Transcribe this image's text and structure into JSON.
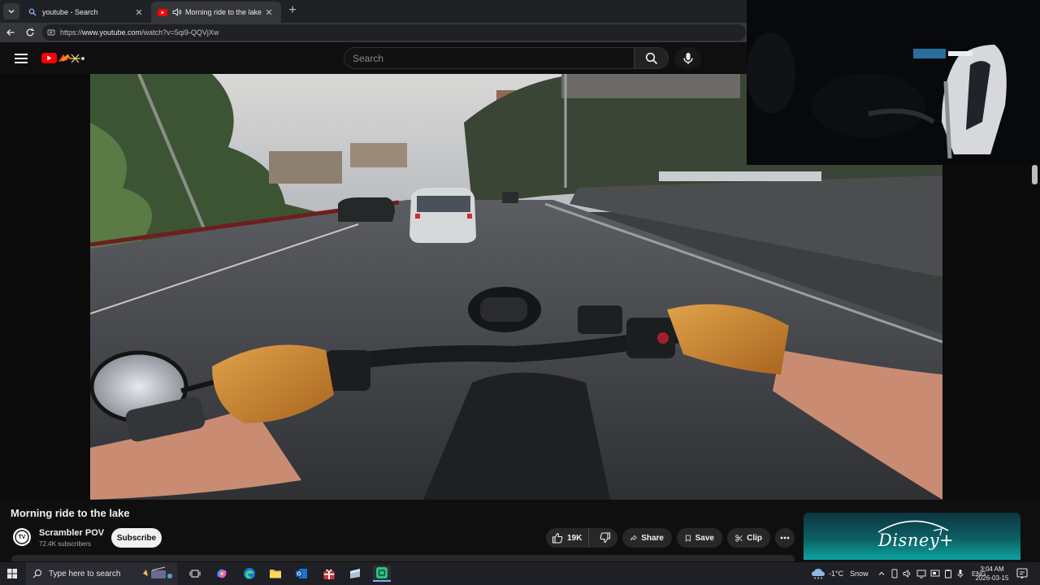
{
  "browser": {
    "tabs": [
      {
        "title": "youtube - Search",
        "active": false
      },
      {
        "title": "Morning ride to the lake - Yo",
        "active": true
      }
    ],
    "url_prefix": "https://",
    "url_host": "www.youtube.com",
    "url_path": "/watch?v=5qi9-QQVjXw"
  },
  "youtube": {
    "search_placeholder": "Search",
    "video_title": "Morning ride to the lake",
    "channel_name": "Scrambler POV",
    "channel_subscribers": "72.4K subscribers",
    "channel_avatar_text": "TV",
    "subscribe_label": "Subscribe",
    "likes": "19K",
    "share_label": "Share",
    "save_label": "Save",
    "clip_label": "Clip",
    "ad_brand": "Disney+"
  },
  "taskbar": {
    "search_placeholder": "Type here to search",
    "weather_temp": "-1°C",
    "weather_condition": "Snow",
    "language": "ENG",
    "time": "3:04 AM",
    "date": "2026-03-15"
  },
  "colors": {
    "youtube_red": "#ff0000",
    "background": "#0f0f0f",
    "pill": "#272727",
    "taskbar": "#1f1f26",
    "ad_teal": "#0ba4a0"
  }
}
